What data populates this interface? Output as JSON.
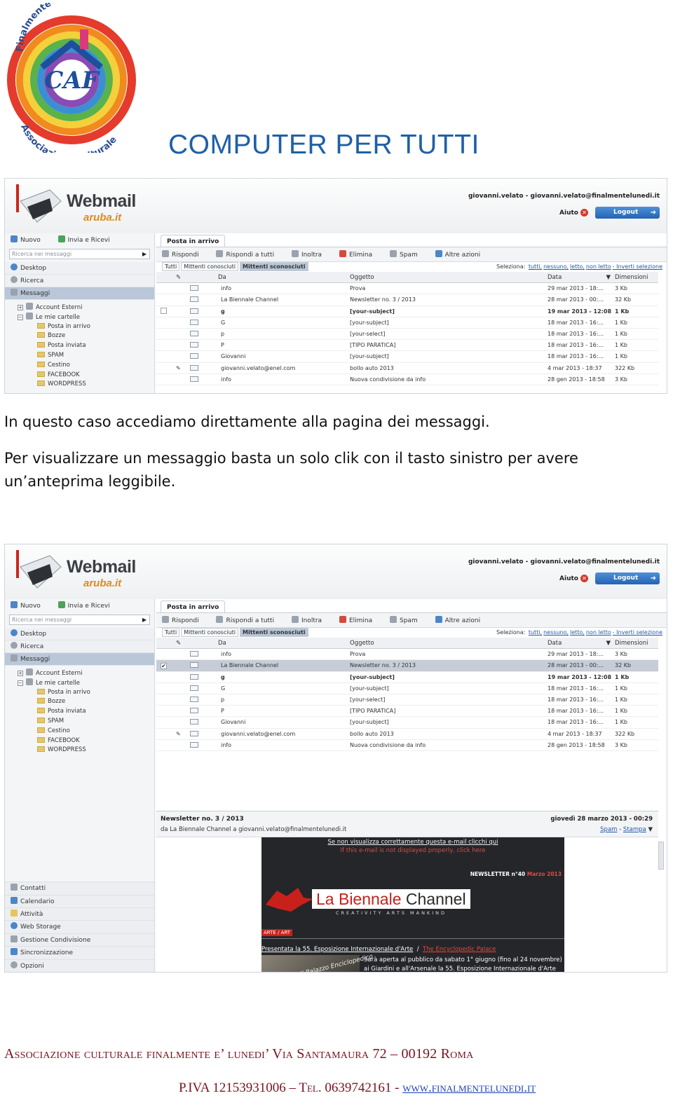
{
  "header": {
    "logo_text": {
      "top": "Finalmente è Lunedì",
      "mark": "CAF",
      "bottom": "Associazione Culturale"
    },
    "title": "COMPUTER PER TUTTI"
  },
  "colors": {
    "title": "#1f5fa8",
    "footer": "#7b1220",
    "link": "#1d3fb5",
    "webmail_accent": "#2463b3"
  },
  "webmail": {
    "brand": "Webmail",
    "brand_sub": "aruba.it",
    "user": "giovanni.velato - giovanni.velato@finalmentelunedi.it",
    "help": "Aiuto",
    "logout": "Logout",
    "left_top": [
      "Nuovo",
      "Invia e Ricevi"
    ],
    "search_placeholder": "Ricerca nei messaggi",
    "nav": [
      "Desktop",
      "Ricerca",
      "Messaggi"
    ],
    "tree": {
      "account_esterni": "Account Esterni",
      "le_mie_cartelle": "Le mie cartelle",
      "folders": [
        "Posta in arrivo",
        "Bozze",
        "Posta inviata",
        "SPAM",
        "Cestino",
        "FACEBOOK",
        "WORDPRESS"
      ]
    },
    "left_bottom": [
      "Contatti",
      "Calendario",
      "Attività",
      "Web Storage",
      "Gestione Condivisione",
      "Sincronizzazione",
      "Opzioni"
    ],
    "main_tab": "Posta in arrivo",
    "toolbar": [
      "Rispondi",
      "Rispondi a tutti",
      "Inoltra",
      "Elimina",
      "Spam",
      "Altre azioni"
    ],
    "filter_tabs": [
      "Tutti",
      "Mittenti conosciuti",
      "Mittenti sconosciuti"
    ],
    "select_label": "Seleziona:",
    "select_links": [
      "tutti,",
      "nessuno,",
      "letto,",
      "non letto",
      "- Inverti selezione"
    ],
    "columns": {
      "from": "Da",
      "subject": "Oggetto",
      "date": "Data",
      "size": "Dimensioni"
    },
    "messages": [
      {
        "from": "info",
        "subject": "Prova",
        "date": "29 mar 2013 - 18:...",
        "size": "3 Kb",
        "unread": false,
        "attach": false
      },
      {
        "from": "La Biennale Channel",
        "subject": "Newsletter no. 3 / 2013",
        "date": "28 mar 2013 - 00:...",
        "size": "32 Kb",
        "unread": false,
        "attach": false
      },
      {
        "from": "g",
        "subject": "[your-subject]",
        "date": "19 mar 2013 - 12:08",
        "size": "1 Kb",
        "unread": true,
        "attach": false
      },
      {
        "from": "G",
        "subject": "[your-subject]",
        "date": "18 mar 2013 - 16:...",
        "size": "1 Kb",
        "unread": false,
        "attach": false
      },
      {
        "from": "p",
        "subject": "[your-select]",
        "date": "18 mar 2013 - 16:...",
        "size": "1 Kb",
        "unread": false,
        "attach": false
      },
      {
        "from": "P",
        "subject": "[TIPO PARATICA]",
        "date": "18 mar 2013 - 16:...",
        "size": "1 Kb",
        "unread": false,
        "attach": false
      },
      {
        "from": "Giovanni",
        "subject": "[your-subject]",
        "date": "18 mar 2013 - 16:...",
        "size": "1 Kb",
        "unread": false,
        "attach": false
      },
      {
        "from": "giovanni.velato@enel.com",
        "subject": "bollo auto 2013",
        "date": "4 mar 2013 - 18:37",
        "size": "322 Kb",
        "unread": false,
        "attach": true
      },
      {
        "from": "info",
        "subject": "Nuova condivisione da info",
        "date": "28 gen 2013 - 18:58",
        "size": "3 Kb",
        "unread": false,
        "attach": false
      }
    ],
    "preview": {
      "subject": "Newsletter no. 3 / 2013",
      "from_line": "da La Biennale Channel a giovanni.velato@finalmentelunedi.it",
      "date": "giovedì 28 marzo 2013 - 00:29",
      "link_spam": "Spam",
      "link_sep": "-",
      "link_print": "Stampa"
    },
    "newsletter": {
      "line1": "Se non visualizza correttamente questa e-mail clicchi qui",
      "line2": "If this e-mail is not displayed properly, click here",
      "issue": "NEWSLETTER n°40",
      "issue_date": "Marzo 2013",
      "brand_a": "La Biennale",
      "brand_b": "Channel",
      "tagline": "CREATIVITY ARTS MANKIND",
      "category": "ARTE / ART",
      "headline_a": "Presentata la 55. Esposizione Internazionale d'Arte",
      "headline_sep": "/",
      "headline_b": "The Encyclopedic Palace",
      "thumb_text": "Il Palazzo Enciclopedico",
      "body1": "Sarà aperta al pubblico da sabato 1° giugno (fino al 24 novembre)",
      "body2": "ai Giardini e all'Arsenale la 55. Esposizione Internazionale d'Arte"
    }
  },
  "text": {
    "p1": "In questo caso accediamo direttamente alla pagina dei messaggi.",
    "p2": "Per visualizzare un messaggio basta un solo clik con il tasto sinistro per avere",
    "p3": "un’anteprima leggibile."
  },
  "footer": {
    "line1": "Associazione culturale finalmente e’ lunedi’   Via Santamaura 72 – 00192 Roma",
    "line2_prefix": "P.IVA 12153931006 – Tel. 0639742161 - ",
    "website": "www.finalmentelunedi.it"
  }
}
